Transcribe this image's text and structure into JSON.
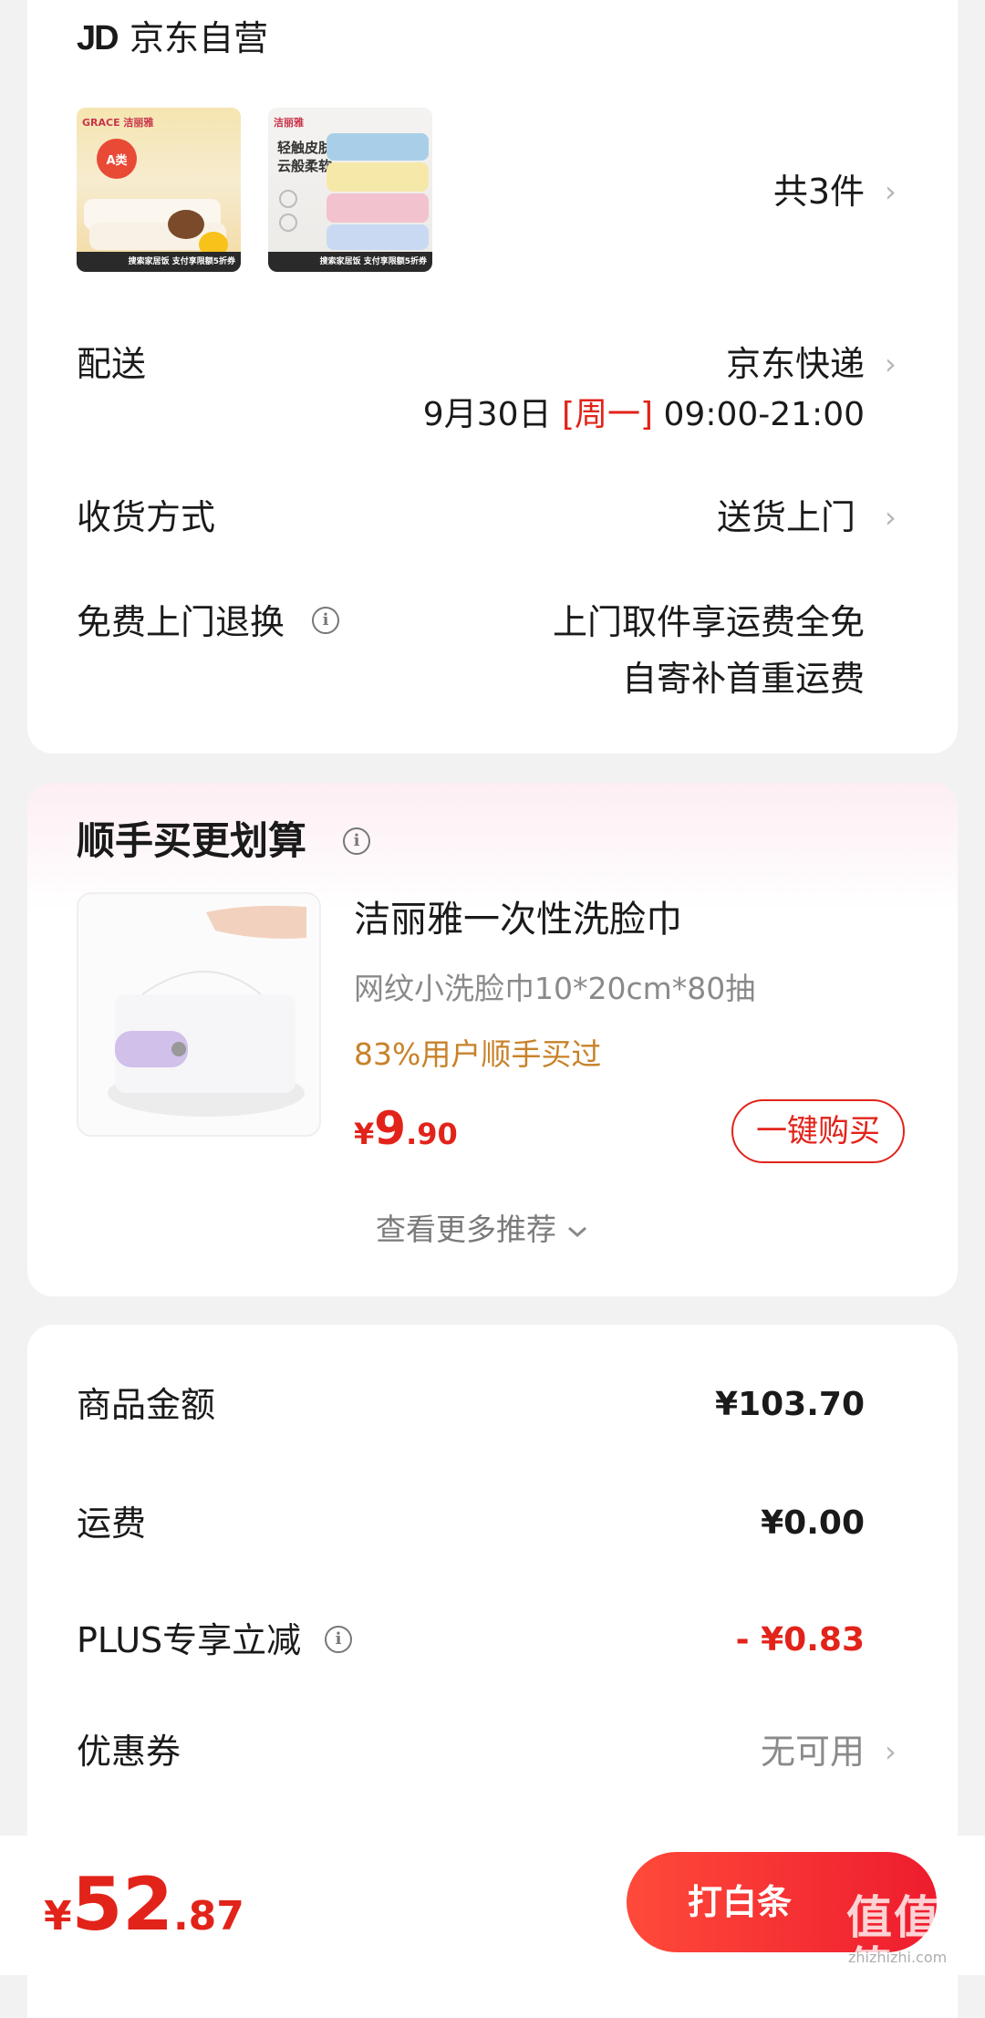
{
  "shop": {
    "logo": "JD",
    "name": "京东自营"
  },
  "products": {
    "thumb1": {
      "brand": "GRACE 洁丽雅",
      "badge": "搜索家居饭 支付享限额5折券"
    },
    "thumb2": {
      "brand": "洁丽雅",
      "tagline": "轻触皮肤\n云般柔软",
      "badge": "搜索家居饭 支付享限额5折券"
    },
    "count_label": "共3件"
  },
  "delivery": {
    "label": "配送",
    "carrier": "京东快递",
    "date": "9月30日",
    "weekday": "[周一]",
    "time_window": "09:00-21:00"
  },
  "receive": {
    "label": "收货方式",
    "value": "送货上门"
  },
  "returns": {
    "label": "免费上门退换",
    "line1": "上门取件享运费全免",
    "line2": "自寄补首重运费"
  },
  "recommend": {
    "title": "顺手买更划算",
    "product_name": "洁丽雅一次性洗脸巾",
    "spec": "网纹小洗脸巾10*20cm*80抽",
    "social_proof": "83%用户顺手买过",
    "price_symbol": "¥",
    "price_int": "9",
    "price_dec": ".90",
    "buy_label": "一键购买",
    "more_label": "查看更多推荐"
  },
  "summary": {
    "goods_label": "商品金额",
    "goods_value": "¥103.70",
    "shipping_label": "运费",
    "shipping_value": "¥0.00",
    "plus_label": "PLUS专享立减",
    "plus_value": "- ¥0.83",
    "coupon_label": "优惠券",
    "coupon_value": "无可用"
  },
  "checkout": {
    "symbol": "¥",
    "total_int": "52",
    "total_dec": ".87",
    "pay_label": "打白条"
  },
  "watermark": {
    "text": "值值值",
    "sub": "zhizhizhi.com"
  },
  "colors": {
    "accent": "#e2231a",
    "orange": "#c8822a",
    "muted": "#888888"
  }
}
